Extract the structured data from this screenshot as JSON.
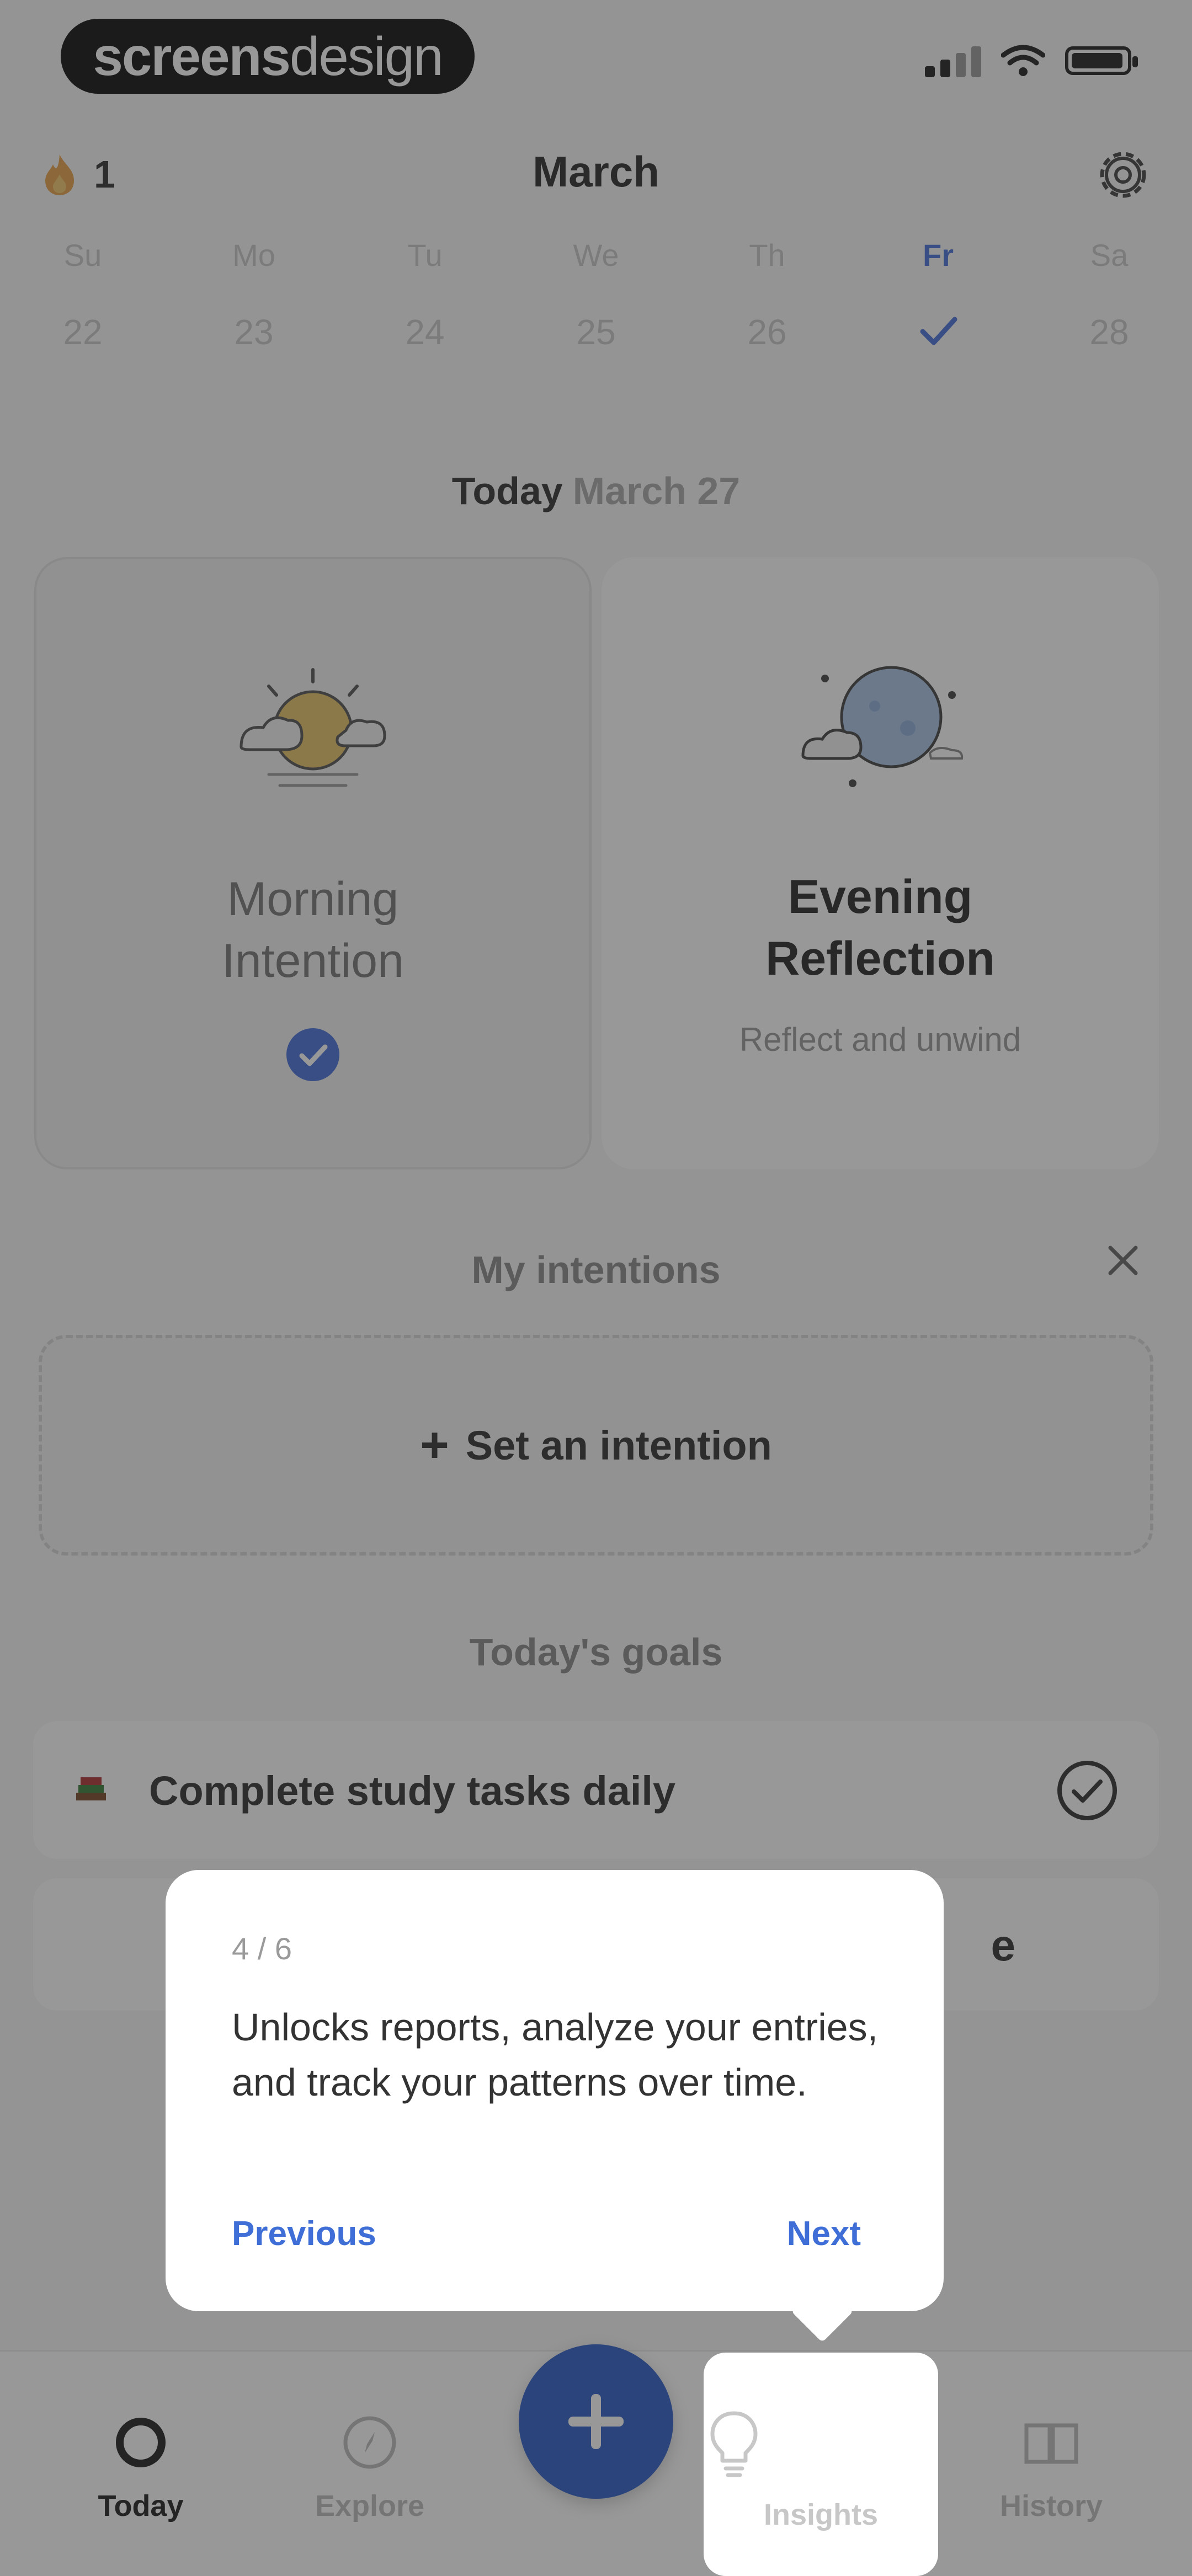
{
  "status_bar": {
    "brand_bold": "screens",
    "brand_light": "design"
  },
  "header": {
    "streak_count": "1",
    "month": "March"
  },
  "week": [
    {
      "name": "Su",
      "num": "22"
    },
    {
      "name": "Mo",
      "num": "23"
    },
    {
      "name": "Tu",
      "num": "24"
    },
    {
      "name": "We",
      "num": "25"
    },
    {
      "name": "Th",
      "num": "26"
    },
    {
      "name": "Fr",
      "num": ""
    },
    {
      "name": "Sa",
      "num": "28"
    }
  ],
  "today": {
    "label": "Today",
    "date": "March 27"
  },
  "cards": {
    "morning": {
      "title_line1": "Morning",
      "title_line2": "Intention"
    },
    "evening": {
      "title_line1": "Evening",
      "title_line2": "Reflection",
      "subtitle": "Reflect and unwind"
    }
  },
  "intentions": {
    "title": "My intentions",
    "add_label": "Set an intention"
  },
  "goals": {
    "title": "Today's goals",
    "items": [
      {
        "text": "Complete study tasks daily"
      },
      {
        "text": ""
      }
    ],
    "tail_text": "e"
  },
  "tooltip": {
    "step": "4 / 6",
    "body": "Unlocks reports, analyze your entries, and track your patterns over time.",
    "previous": "Previous",
    "next": "Next"
  },
  "nav": {
    "today": "Today",
    "explore": "Explore",
    "insights": "Insights",
    "history": "History"
  },
  "colors": {
    "accent": "#4a72d8",
    "fab": "#2f5fc8"
  }
}
